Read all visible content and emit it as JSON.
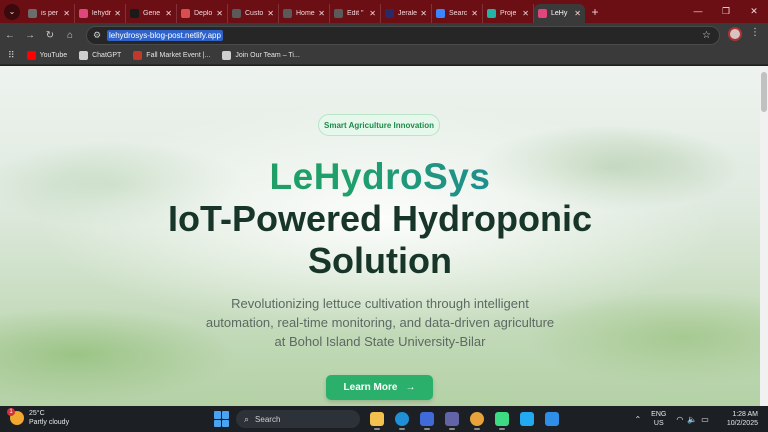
{
  "browser": {
    "tabs": [
      {
        "label": "is per",
        "color": "#6c6c6c",
        "active": false
      },
      {
        "label": "lehydr",
        "color": "#e0457b",
        "active": false
      },
      {
        "label": "Gene",
        "color": "#1a1a1a",
        "active": false
      },
      {
        "label": "Deplo",
        "color": "#d94f4f",
        "active": false
      },
      {
        "label": "Custo",
        "color": "#5a5a5a",
        "active": false
      },
      {
        "label": "Home",
        "color": "#5a5a5a",
        "active": false
      },
      {
        "label": "Edit \"",
        "color": "#5a5a5a",
        "active": false
      },
      {
        "label": "Jerale",
        "color": "#2a2a6a",
        "active": false
      },
      {
        "label": "Searc",
        "color": "#3a86ff",
        "active": false
      },
      {
        "label": "Proje",
        "color": "#22b3a6",
        "active": false
      },
      {
        "label": "LeHy",
        "color": "#e0457b",
        "active": true
      }
    ],
    "new_tab": "+",
    "window_controls": {
      "minimize": "—",
      "restore": "❐",
      "close": "✕"
    },
    "url": "lehydrosys-blog-post.netlify.app",
    "bookmarks": [
      {
        "label": "YouTube",
        "color": "#ff0000"
      },
      {
        "label": "ChatGPT",
        "color": "#cfcfcf"
      },
      {
        "label": "Fall Market Event |...",
        "color": "#c0392b"
      },
      {
        "label": "Join Our Team – Ti...",
        "color": "#cfcfcf"
      }
    ]
  },
  "hero": {
    "badge": "Smart Agriculture Innovation",
    "brand": "LeHydroSys",
    "headline_line1": "IoT-Powered Hydroponic",
    "headline_line2": "Solution",
    "subtitle_line1": "Revolutionizing lettuce cultivation through intelligent",
    "subtitle_line2": "automation, real-time monitoring, and data-driven agriculture",
    "subtitle_line3": "at Bohol Island State University-Bilar",
    "cta_label": "Learn More",
    "cta_arrow": "→",
    "colors": {
      "accent": "#2bb06b",
      "heading": "#173528",
      "brand_start": "#1e9a5a",
      "brand_end": "#1e6fd0"
    }
  },
  "taskbar": {
    "weather_temp": "25°C",
    "weather_desc": "Partly cloudy",
    "weather_badge": "1",
    "search_placeholder": "Search",
    "apps": [
      {
        "name": "file-explorer-icon",
        "color": "#f2c14e"
      },
      {
        "name": "edge-icon",
        "color": "#1f8fd6"
      },
      {
        "name": "store-icon",
        "color": "#3f6ad8"
      },
      {
        "name": "teams-icon",
        "color": "#6264a7"
      },
      {
        "name": "chrome-icon",
        "color": "#e8a33a"
      },
      {
        "name": "android-studio-icon",
        "color": "#3ddc84"
      },
      {
        "name": "vscode-icon",
        "color": "#23a9f2"
      },
      {
        "name": "snipping-tool-icon",
        "color": "#2f8fe8"
      }
    ],
    "lang_top": "ENG",
    "lang_bottom": "US",
    "time": "1:28 AM",
    "date": "10/2/2025"
  }
}
